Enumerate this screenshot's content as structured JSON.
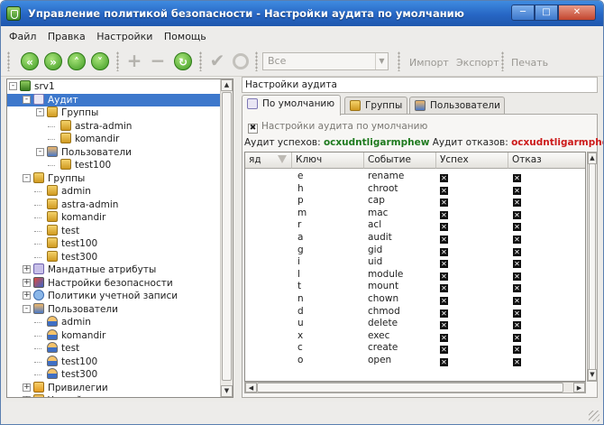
{
  "window": {
    "title": "Управление политикой безопасности - Настройки аудита по умолчанию"
  },
  "menu": [
    "Файл",
    "Правка",
    "Настройки",
    "Помощь"
  ],
  "toolbar": {
    "filter_value": "Все",
    "import_label": "Импорт",
    "export_label": "Экспорт",
    "print_label": "Печать"
  },
  "tree": [
    {
      "label": "srv1",
      "icon": "server-icon",
      "level": 0,
      "expander": "-"
    },
    {
      "label": "Аудит",
      "icon": "audit-icon",
      "level": 1,
      "expander": "-",
      "selected": true
    },
    {
      "label": "Группы",
      "icon": "group-icon",
      "level": 2,
      "expander": "-"
    },
    {
      "label": "astra-admin",
      "icon": "group-icon",
      "level": 3
    },
    {
      "label": "komandir",
      "icon": "group-icon",
      "level": 3
    },
    {
      "label": "Пользователи",
      "icon": "users-icon",
      "level": 2,
      "expander": "-"
    },
    {
      "label": "test100",
      "icon": "group-icon",
      "level": 3
    },
    {
      "label": "Группы",
      "icon": "group-icon",
      "level": 1,
      "expander": "-"
    },
    {
      "label": "admin",
      "icon": "group-icon",
      "level": 2
    },
    {
      "label": "astra-admin",
      "icon": "group-icon",
      "level": 2
    },
    {
      "label": "komandir",
      "icon": "group-icon",
      "level": 2
    },
    {
      "label": "test",
      "icon": "group-icon",
      "level": 2
    },
    {
      "label": "test100",
      "icon": "group-icon",
      "level": 2
    },
    {
      "label": "test300",
      "icon": "group-icon",
      "level": 2
    },
    {
      "label": "Мандатные атрибуты",
      "icon": "mandatory-attributes-icon",
      "level": 1,
      "expander": "+"
    },
    {
      "label": "Настройки безопасности",
      "icon": "security-settings-icon",
      "level": 1,
      "expander": "+"
    },
    {
      "label": "Политики учетной записи",
      "icon": "account-policy-icon",
      "level": 1,
      "expander": "+"
    },
    {
      "label": "Пользователи",
      "icon": "users-icon",
      "level": 1,
      "expander": "-"
    },
    {
      "label": "admin",
      "icon": "user-icon",
      "level": 2
    },
    {
      "label": "komandir",
      "icon": "user-icon",
      "level": 2
    },
    {
      "label": "test",
      "icon": "user-icon",
      "level": 2
    },
    {
      "label": "test100",
      "icon": "user-icon",
      "level": 2
    },
    {
      "label": "test300",
      "icon": "user-icon",
      "level": 2
    },
    {
      "label": "Привилегии",
      "icon": "privileges-icon",
      "level": 1,
      "expander": "+"
    },
    {
      "label": "Устройства и правила",
      "icon": "devices-icon",
      "level": 1,
      "expander": "+"
    }
  ],
  "breadcrumb": "Настройки аудита",
  "tabs": [
    "По умолчанию",
    "Группы",
    "Пользователи"
  ],
  "checkbox_label": "Настройки аудита по умолчанию",
  "audit": {
    "success_label": "Аудит успехов:",
    "success_value": "ocxudntligarmphew",
    "failure_label": "Аудит отказов:",
    "failure_value": "ocxudntligarmphew"
  },
  "table": {
    "headers": [
      "яд",
      "Ключ",
      "Событие",
      "Успех",
      "Отказ"
    ],
    "rows": [
      [
        "e",
        "rename"
      ],
      [
        "h",
        "chroot"
      ],
      [
        "p",
        "cap"
      ],
      [
        "m",
        "mac"
      ],
      [
        "r",
        "acl"
      ],
      [
        "a",
        "audit"
      ],
      [
        "g",
        "gid"
      ],
      [
        "i",
        "uid"
      ],
      [
        "l",
        "module"
      ],
      [
        "t",
        "mount"
      ],
      [
        "n",
        "chown"
      ],
      [
        "d",
        "chmod"
      ],
      [
        "u",
        "delete"
      ],
      [
        "x",
        "exec"
      ],
      [
        "c",
        "create"
      ],
      [
        "o",
        "open"
      ]
    ]
  }
}
